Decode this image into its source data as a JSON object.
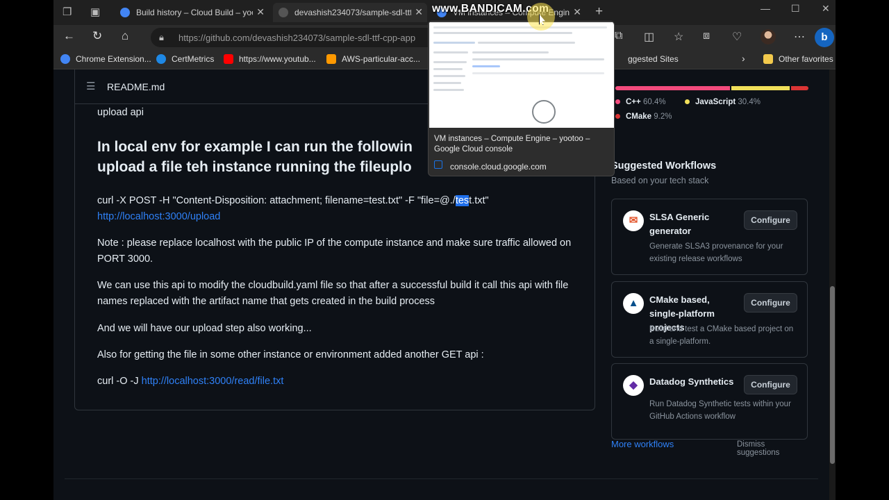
{
  "tabs": [
    {
      "title": "Build history – Cloud Build – yoo",
      "favicon_color": "#4285f4"
    },
    {
      "title": "devashish234073/sample-sdl-ttf-",
      "favicon_color": "#555555",
      "active": true
    },
    {
      "title": "VM instances – Compute Engine",
      "favicon_color": "#4285f4"
    }
  ],
  "address_bar": {
    "url": "https://github.com/devashish234073/sample-sdl-ttf-cpp-app"
  },
  "favorites": [
    {
      "label": "Chrome Extension...",
      "color": "#4285f4"
    },
    {
      "label": "CertMetrics",
      "color": "#1e88e5"
    },
    {
      "label": "https://www.youtub...",
      "color": "#ff0000"
    },
    {
      "label": "AWS-particular-acc...",
      "color": "#ff9900"
    },
    {
      "label": "ggested Sites",
      "color": "#e0e0e0"
    },
    {
      "label": "Other favorites",
      "color": "#f2c94c"
    }
  ],
  "readme": {
    "filename": "README.md",
    "line0": "upload api",
    "heading": "In local env for example I can run the followin upload a file teh instance running the fileuplo",
    "heading_line1": "In local env for example I can run the followin",
    "heading_line2": "upload a file teh instance running the fileuplo",
    "curl1_a": "curl -X POST -H \"Content-Disposition: attachment; filename=test.txt\" -F \"file=@./",
    "curl1_hl": "tes",
    "curl1_b": "t.txt\"",
    "curl1_link": "http://localhost:3000/upload",
    "note": "Note : please replace localhost with the public IP of the compute instance and make sure traffic allowed on PORT 3000.",
    "para1": "We can use this api to modify the cloudbuild.yaml file so that after a successful build it call this api with file names replaced with the artifact name that gets created in the build process",
    "para2": "And we will have our upload step also working...",
    "para3": "Also for getting the file in some other instance or environment added another GET api :",
    "curl2_prefix": "curl -O -J ",
    "curl2_link": "http://localhost:3000/read/file.txt"
  },
  "languages": [
    {
      "name": "C++",
      "percent": "60.4%",
      "fraction": 0.604,
      "color": "#f34b7d"
    },
    {
      "name": "JavaScript",
      "percent": "30.4%",
      "fraction": 0.304,
      "color": "#f1e05a"
    },
    {
      "name": "CMake",
      "percent": "9.2%",
      "fraction": 0.092,
      "color": "#da3434"
    }
  ],
  "suggested": {
    "title": "Suggested Workflows",
    "subtitle": "Based on your tech stack",
    "workflows": [
      {
        "name": "SLSA Generic generator",
        "description": "Generate SLSA3 provenance for your existing release workflows",
        "button": "Configure",
        "logo_color": "#e4572e"
      },
      {
        "name": "CMake based, single-platform projects",
        "description": "Build and test a CMake based project on a single-platform.",
        "button": "Configure",
        "logo_color": "#064f8c"
      },
      {
        "name": "Datadog Synthetics",
        "description": "Run Datadog Synthetic tests within your GitHub Actions workflow",
        "button": "Configure",
        "logo_color": "#632ca6"
      }
    ],
    "more": "More workflows",
    "dismiss": "Dismiss suggestions"
  },
  "preview": {
    "title": "VM instances – Compute Engine – yootoo – Google Cloud console",
    "url": "console.cloud.google.com"
  },
  "watermark": "www.BANDICAM.com"
}
